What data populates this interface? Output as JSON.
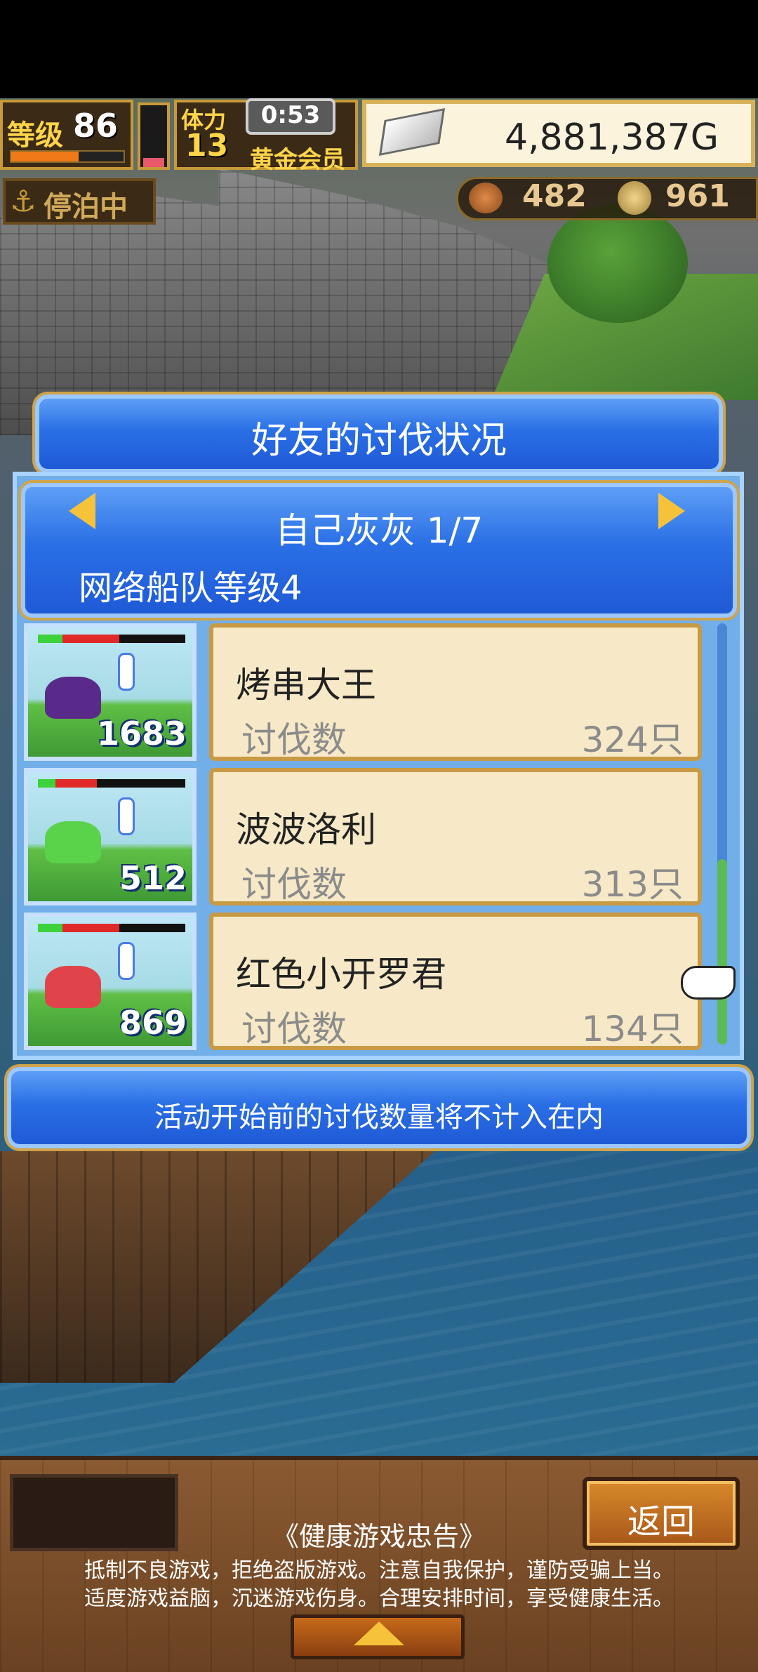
{
  "hud": {
    "level_label": "等级",
    "level_value": "86",
    "level_progress": 0.6,
    "stamina_gauge": 0.15,
    "stamina_label": "体力",
    "stamina_value": "13",
    "timer": "0:53",
    "vip_label": "黄金会员",
    "gold": "4,881,387G",
    "docked_label": "停泊中",
    "resources": {
      "meat": "482",
      "coin": "961"
    },
    "icons": [
      "silver-bar-icon",
      "anchor-icon",
      "meat-icon",
      "coin-icon"
    ]
  },
  "dialog": {
    "title": "好友的讨伐状况",
    "friend_name": "自己灰灰 1/7",
    "fleet_level": "网络船队等级4",
    "rows": [
      {
        "name": "烤串大王",
        "label": "讨伐数",
        "count": "324只",
        "thumb_value": "1683",
        "hp": 0.55,
        "monster_color": "#5a2a8a"
      },
      {
        "name": "波波洛利",
        "label": "讨伐数",
        "count": "313只",
        "thumb_value": "512",
        "hp": 0.4,
        "monster_color": "#5ad24a"
      },
      {
        "name": "红色小开罗君",
        "label": "讨伐数",
        "count": "134只",
        "thumb_value": "869",
        "hp": 0.55,
        "monster_color": "#e0444a"
      }
    ],
    "notice": "活动开始前的讨伐数量将不计入在内"
  },
  "bottom": {
    "back_label": "返回",
    "advisory_title": "《健康游戏忠告》",
    "advisory_line1": "抵制不良游戏，拒绝盗版游戏。注意自我保护，谨防受骗上当。",
    "advisory_line2": "适度游戏益脑，沉迷游戏伤身。合理安排时间，享受健康生活。"
  },
  "colors": {
    "panel_blue": "#2a6fe6",
    "card_bg": "#f7e9c7",
    "gold_text": "#ffd54a",
    "count_gray": "#8b8b8b"
  }
}
